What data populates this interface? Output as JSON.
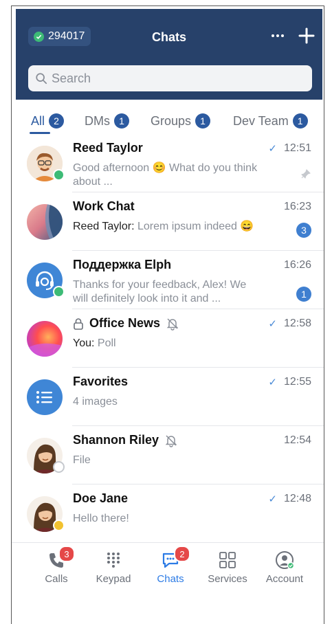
{
  "header": {
    "account_id": "294017",
    "title": "Chats",
    "more_icon": "more-horizontal-icon",
    "add_icon": "plus-icon"
  },
  "search": {
    "placeholder": "Search"
  },
  "tabs": [
    {
      "label": "All",
      "count": "2",
      "active": true
    },
    {
      "label": "DMs",
      "count": "1"
    },
    {
      "label": "Groups",
      "count": "1"
    },
    {
      "label": "Dev Team",
      "count": "1"
    }
  ],
  "chats": [
    {
      "name": "Reed Taylor",
      "time": "12:51",
      "read": true,
      "preview": "Good afternoon 😊 What do you think about ...",
      "pinned": true,
      "status_color": "#3dbb76"
    },
    {
      "name": "Work Chat",
      "time": "16:23",
      "sender": "Reed Taylor:",
      "preview": "Lorem ipsum indeed 😄",
      "unread": "3"
    },
    {
      "name": "Поддержка Elph",
      "time": "16:26",
      "preview": "Thanks for your feedback, Alex! We will definitely look into it and ...",
      "unread": "1",
      "status_color": "#3dbb76"
    },
    {
      "name": "Office News",
      "time": "12:58",
      "read": true,
      "sender": "You:",
      "preview": "Poll",
      "locked": true,
      "muted": true
    },
    {
      "name": "Favorites",
      "time": "12:55",
      "read": true,
      "preview": "4 images"
    },
    {
      "name": "Shannon Riley",
      "time": "12:54",
      "preview": "File",
      "muted": true,
      "status_color": "#ffffff"
    },
    {
      "name": "Doe Jane",
      "time": "12:48",
      "read": true,
      "preview": "Hello there!",
      "status_color": "#f2c230"
    }
  ],
  "nav": [
    {
      "label": "Calls",
      "badge": "3"
    },
    {
      "label": "Keypad"
    },
    {
      "label": "Chats",
      "badge": "2",
      "active": true
    },
    {
      "label": "Services"
    },
    {
      "label": "Account"
    }
  ],
  "colors": {
    "header_bg": "#27416a",
    "accent": "#2c5aa0",
    "active_nav": "#2c7be5",
    "badge_red": "#e54848"
  }
}
